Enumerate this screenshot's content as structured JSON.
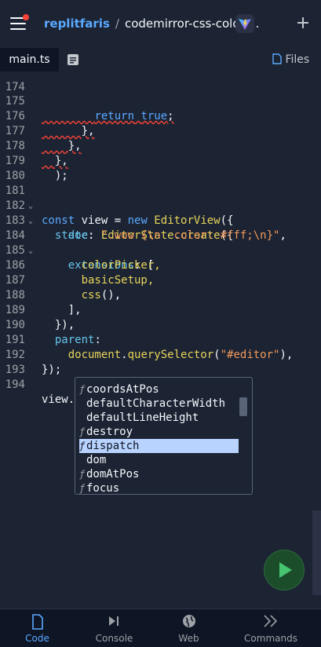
{
  "header": {
    "username": "replitfaris",
    "separator": "/",
    "repl_name": "codemirror-css-color-...",
    "add_icon": "plus-icon"
  },
  "tabs": {
    "file": "main.ts",
    "files_label": "Files"
  },
  "editor": {
    "top_partial_line": "174",
    "lines": [
      {
        "n": "175",
        "fold": false
      },
      {
        "n": "176",
        "fold": false
      },
      {
        "n": "177",
        "fold": false
      },
      {
        "n": "178",
        "fold": false
      },
      {
        "n": "179",
        "fold": false
      },
      {
        "n": "180",
        "fold": false
      },
      {
        "n": "181",
        "fold": true
      },
      {
        "n": "182",
        "fold": true
      },
      {
        "n": "183",
        "fold": false
      },
      {
        "n": "184",
        "fold": true
      },
      {
        "n": "185",
        "fold": false
      },
      {
        "n": "186",
        "fold": false
      },
      {
        "n": "187",
        "fold": false
      },
      {
        "n": "188",
        "fold": false
      },
      {
        "n": "189",
        "fold": false
      },
      {
        "n": "190",
        "fold": false
      },
      {
        "n": "191",
        "fold": false
      },
      {
        "n": "192",
        "fold": false
      },
      {
        "n": "193",
        "fold": false
      },
      {
        "n": "194",
        "fold": false
      }
    ],
    "tokens": {
      "return": "return",
      "true": "true",
      "semi": ";",
      "close_brace_comma": "},",
      "close_paren_semi": ");",
      "const": "const",
      "view": "view",
      "equals": " = ",
      "new": "new",
      "EditorView": "EditorView",
      "open_paren_brace": "({",
      "state": "state",
      "colon": ": ",
      "EditorState": "EditorState",
      "dot": ".",
      "create": "create",
      "doc": "doc",
      "doc_value": "\".wow {\\n  color: #fff;\\n}\"",
      "comma": ",",
      "extensions": "extensions",
      "open_bracket": "[",
      "colorPicker": "colorPicker,",
      "basicSetup": "basicSetup,",
      "css": "css",
      "call_comma": "(),",
      "close_bracket_comma": "],",
      "close_brace_paren_comma": "}),",
      "parent": "parent",
      "colon_only": ":",
      "document": "document",
      "querySelector": "querySelector",
      "selector_value": "\"#editor\"",
      "close_paren_comma": "),",
      "close_brace_paren_semi": "});",
      "view_dot": "view."
    }
  },
  "autocomplete": {
    "items": [
      {
        "kind": "ƒ",
        "label": "coordsAtPos",
        "selected": false
      },
      {
        "kind": "",
        "label": "defaultCharacterWidth",
        "selected": false
      },
      {
        "kind": "",
        "label": "defaultLineHeight",
        "selected": false
      },
      {
        "kind": "ƒ",
        "label": "destroy",
        "selected": false
      },
      {
        "kind": "ƒ",
        "label": "dispatch",
        "selected": true
      },
      {
        "kind": "",
        "label": "dom",
        "selected": false
      },
      {
        "kind": "ƒ",
        "label": "domAtPos",
        "selected": false
      },
      {
        "kind": "ƒ",
        "label": "focus",
        "selected": false
      }
    ]
  },
  "bottom_nav": {
    "items": [
      {
        "label": "Code",
        "icon": "file-icon",
        "active": true
      },
      {
        "label": "Console",
        "icon": "console-icon",
        "active": false
      },
      {
        "label": "Web",
        "icon": "globe-icon",
        "active": false
      },
      {
        "label": "Commands",
        "icon": "chevrons-icon",
        "active": false
      }
    ]
  },
  "colors": {
    "background": "#1c2333",
    "accent": "#5aa9ff",
    "run_green": "#46c46f",
    "selection": "#b9d3ff"
  }
}
